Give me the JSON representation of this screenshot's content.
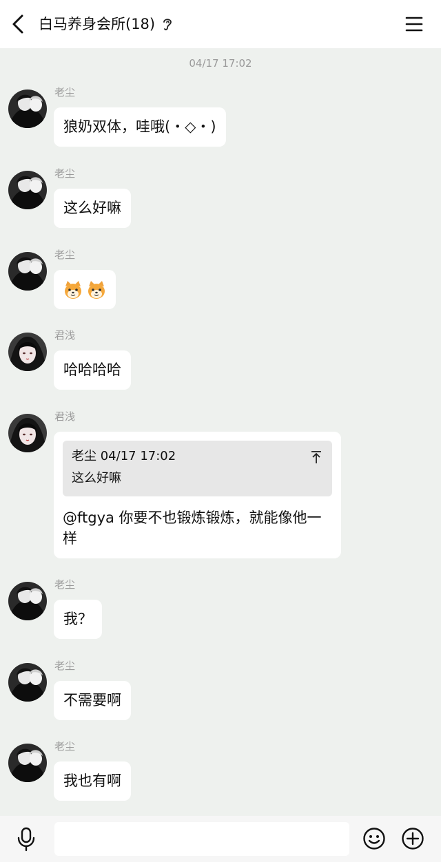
{
  "header": {
    "title": "白马养身会所(18)",
    "back_icon": "chevron-left-icon",
    "ear_icon": "ear-icon",
    "menu_icon": "hamburger-menu-icon"
  },
  "chat": {
    "timestamp": "04/17 17:02",
    "messages": [
      {
        "sender": "老尘",
        "avatar": "avatar-laochen",
        "text": "狼奶双体，哇哦(・◇・)"
      },
      {
        "sender": "老尘",
        "avatar": "avatar-laochen",
        "text": "这么好嘛"
      },
      {
        "sender": "老尘",
        "avatar": "avatar-laochen",
        "emojis": [
          "shiba-emoji",
          "shiba-emoji"
        ]
      },
      {
        "sender": "君浅",
        "avatar": "avatar-junqian",
        "text": "哈哈哈哈"
      },
      {
        "sender": "君浅",
        "avatar": "avatar-junqian",
        "quote": {
          "author": "老尘",
          "time": "04/17 17:02",
          "text": "这么好嘛"
        },
        "text": "@ftgya 你要不也锻炼锻炼，就能像他一样"
      },
      {
        "sender": "老尘",
        "avatar": "avatar-laochen",
        "text": "我？"
      },
      {
        "sender": "老尘",
        "avatar": "avatar-laochen",
        "text": "不需要啊"
      },
      {
        "sender": "老尘",
        "avatar": "avatar-laochen",
        "text": "我也有啊"
      }
    ]
  },
  "composer": {
    "mic_icon": "microphone-icon",
    "input_value": "",
    "emoji_icon": "smiley-icon",
    "plus_icon": "plus-circle-icon"
  }
}
